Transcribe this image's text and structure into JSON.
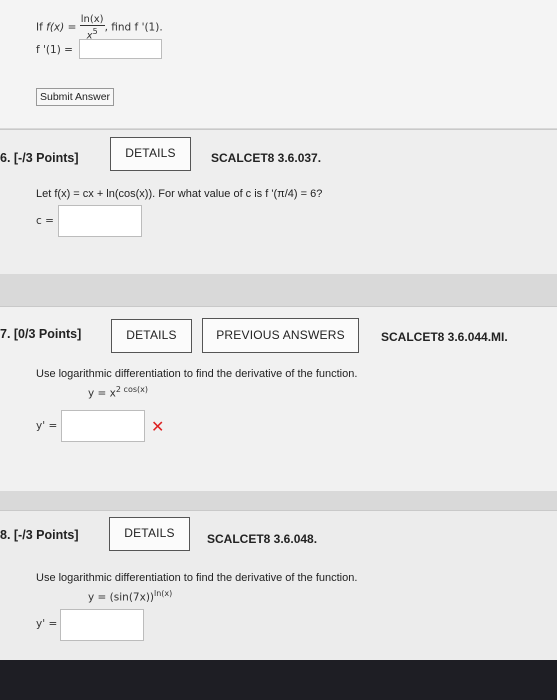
{
  "top": {
    "question": {
      "if": "If",
      "fx": "f(x)",
      "eq": "=",
      "num": "ln(x)",
      "den": "x",
      "den_exp": "5",
      "tail": ", find f '(1)."
    },
    "answer_label": "f '(1) =",
    "answer_value": "",
    "submit_label": "Submit Answer"
  },
  "q6": {
    "points": "6. [-/3 Points]",
    "details_label": "DETAILS",
    "code": "SCALCET8 3.6.037.",
    "text": "Let f(x) = cx + ln(cos(x)). For what value of c is f '(π/4) = 6?",
    "answer_label": "c =",
    "answer_value": ""
  },
  "q7": {
    "points": "7. [0/3 Points]",
    "details_label": "DETAILS",
    "previous_label": "PREVIOUS ANSWERS",
    "code": "SCALCET8 3.6.044.MI.",
    "text": "Use logarithmic differentiation to find the derivative of the function.",
    "function_lhs": "y = x",
    "function_exp": "2 cos(x)",
    "answer_label": "y' =",
    "answer_value": "",
    "status_mark": "✕"
  },
  "q8": {
    "points": "8. [-/3 Points]",
    "details_label": "DETAILS",
    "code": "SCALCET8 3.6.048.",
    "text": "Use logarithmic differentiation to find the derivative of the function.",
    "function_lhs": "y = (sin(7x))",
    "function_exp": "ln(x)",
    "answer_label": "y' =",
    "answer_value": ""
  },
  "colors": {
    "incorrect": "#dd2222",
    "button_border": "#555555",
    "footer": "#1e1e24"
  }
}
